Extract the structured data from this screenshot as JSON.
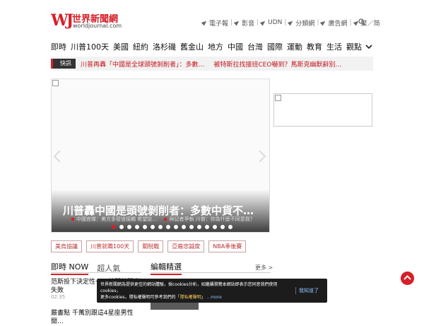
{
  "header": {
    "logo_mark": "WJ",
    "logo_name": "世界新聞網",
    "logo_sub": "worldjournal.com",
    "links": [
      "電子報",
      "影音",
      "UDN",
      "分類網",
      "廣告網"
    ],
    "lang_trad": "繁",
    "lang_sep": "／",
    "lang_simp": "简"
  },
  "nav": [
    "即時",
    "川普100天",
    "美國",
    "紐約",
    "洛杉磯",
    "舊金山",
    "地方",
    "中國",
    "台灣",
    "國際",
    "運動",
    "教育",
    "生活",
    "觀點"
  ],
  "breaking": {
    "badge": "快訊",
    "items": [
      "川普再轟「中國是全球頭號剝削者」：多數…",
      "被特斯拉找接班CEO嚇到？馬斯克幽默辭別…"
    ]
  },
  "hero": {
    "title": "川普轟中國是頭號剝削者：多數中貨不…",
    "subs": [
      "中國官媒：美方多管道接觸 希望談…",
      "與記者爭執 川普：你為什麼不同意我？"
    ],
    "dot_count": 16,
    "active_dot": 0
  },
  "tags": [
    "美烏協議",
    "川普就職100天",
    "關稅戰",
    "亞裔忠誠度",
    "NBA季後賽"
  ],
  "latest": {
    "tab_now": "即時 NOW",
    "tab_hot": "超人氣",
    "items": [
      {
        "title": "范斯投下決定性一…普關稅閘案失敗",
        "time": "02:35"
      },
      {
        "title": "嚴書點 千萬別跟這4星座男性開…",
        "time": ""
      }
    ]
  },
  "editor": {
    "title": "編輯精選",
    "more": "更多 >"
  },
  "cookie": {
    "text_1": "世界新聞網為提供更佳的網站體驗，採cookies分析，如繼續瀏覽本網站即表示您同意我們使用cookies，",
    "text_2": "更多cookies，隱私權聲明可參考我們的「",
    "link": "隱私權聲明",
    "text_3": "」",
    "more": "...more",
    "accept": "我知道了"
  },
  "colors": {
    "brand_red": "#d5202a",
    "breaking_text": "#c4161c"
  }
}
